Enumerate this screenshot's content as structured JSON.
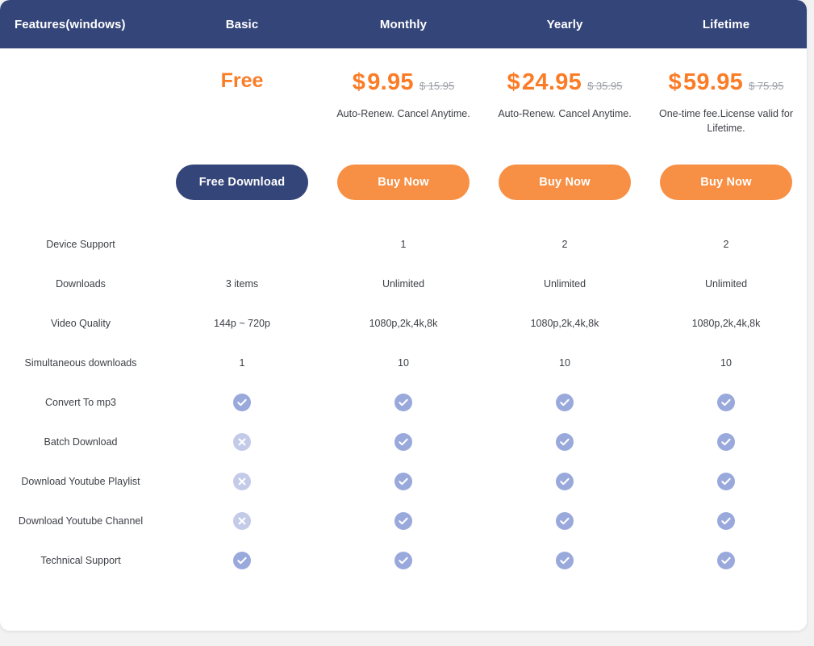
{
  "colors": {
    "header_bg": "#344579",
    "accent_orange": "#fb7c26",
    "button_orange": "#f79044",
    "button_navy": "#344579",
    "check_icon": "#9aa9dc",
    "cross_icon": "#c3cbe9",
    "page_bg": "#f2f2f2",
    "card_bg": "#ffffff",
    "text": "#3c3f45",
    "old_price": "#9b9fa6"
  },
  "header": {
    "feature_column_label": "Features(windows)",
    "plans": [
      "Basic",
      "Monthly",
      "Yearly",
      "Lifetime"
    ]
  },
  "pricing": [
    {
      "plan": "Basic",
      "free_label": "Free",
      "currency": "",
      "price": "",
      "old_price": "",
      "note": "",
      "cta_label": "Free Download",
      "cta_style": "navy"
    },
    {
      "plan": "Monthly",
      "free_label": "",
      "currency": "$",
      "price": "9.95",
      "old_price": "$ 15.95",
      "note": "Auto-Renew. Cancel Anytime.",
      "cta_label": "Buy Now",
      "cta_style": "orange"
    },
    {
      "plan": "Yearly",
      "free_label": "",
      "currency": "$",
      "price": "24.95",
      "old_price": "$ 35.95",
      "note": "Auto-Renew. Cancel Anytime.",
      "cta_label": "Buy Now",
      "cta_style": "orange"
    },
    {
      "plan": "Lifetime",
      "free_label": "",
      "currency": "$",
      "price": "59.95",
      "old_price": "$ 75.95",
      "note": "One-time fee.License valid for Lifetime.",
      "cta_label": "Buy Now",
      "cta_style": "orange"
    }
  ],
  "features": [
    {
      "label": "Device Support",
      "values": [
        "",
        "1",
        "2",
        "2"
      ],
      "types": [
        "text",
        "text",
        "text",
        "text"
      ]
    },
    {
      "label": "Downloads",
      "values": [
        "3 items",
        "Unlimited",
        "Unlimited",
        "Unlimited"
      ],
      "types": [
        "text",
        "text",
        "text",
        "text"
      ]
    },
    {
      "label": "Video Quality",
      "values": [
        "144p ~ 720p",
        "1080p,2k,4k,8k",
        "1080p,2k,4k,8k",
        "1080p,2k,4k,8k"
      ],
      "types": [
        "text",
        "text",
        "text",
        "text"
      ]
    },
    {
      "label": "Simultaneous downloads",
      "values": [
        "1",
        "10",
        "10",
        "10"
      ],
      "types": [
        "text",
        "text",
        "text",
        "text"
      ]
    },
    {
      "label": "Convert To mp3",
      "values": [
        "",
        "",
        "",
        ""
      ],
      "types": [
        "check",
        "check",
        "check",
        "check"
      ]
    },
    {
      "label": "Batch Download",
      "values": [
        "",
        "",
        "",
        ""
      ],
      "types": [
        "cross",
        "check",
        "check",
        "check"
      ]
    },
    {
      "label": "Download Youtube Playlist",
      "values": [
        "",
        "",
        "",
        ""
      ],
      "types": [
        "cross",
        "check",
        "check",
        "check"
      ]
    },
    {
      "label": "Download Youtube Channel",
      "values": [
        "",
        "",
        "",
        ""
      ],
      "types": [
        "cross",
        "check",
        "check",
        "check"
      ]
    },
    {
      "label": "Technical Support",
      "values": [
        "",
        "",
        "",
        ""
      ],
      "types": [
        "check",
        "check",
        "check",
        "check"
      ]
    }
  ],
  "icons": {
    "check_name": "check-circle-icon",
    "cross_name": "cross-circle-icon"
  }
}
